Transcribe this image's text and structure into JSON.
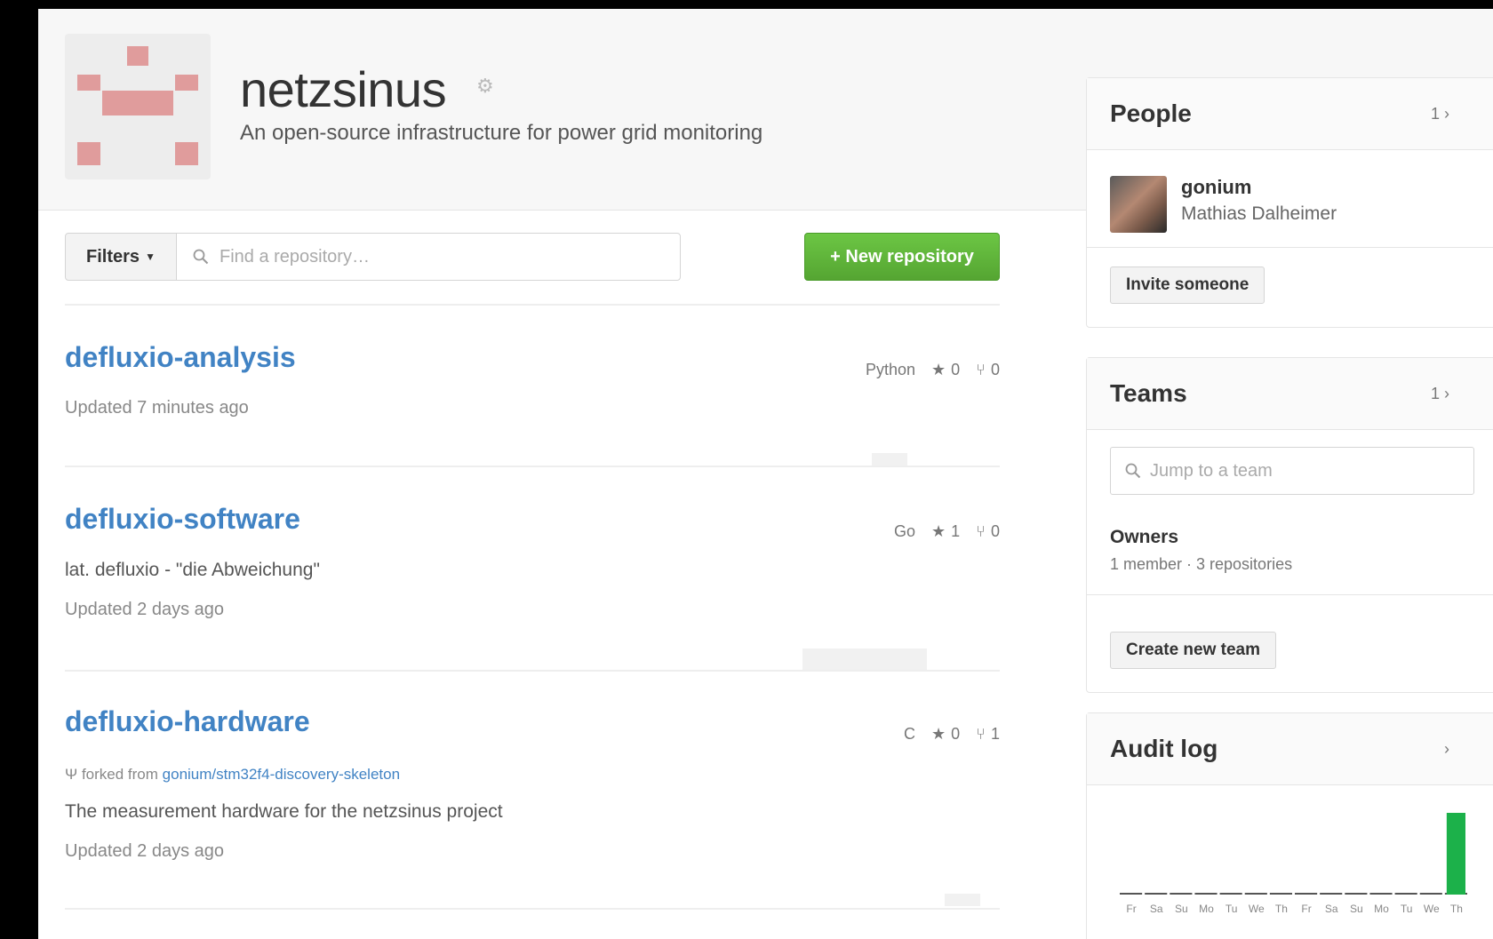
{
  "org": {
    "name": "netzsinus",
    "description": "An open-source infrastructure for power grid monitoring"
  },
  "toolbar": {
    "filters_label": "Filters",
    "search_placeholder": "Find a repository…",
    "new_repo_label": "+ New repository"
  },
  "repos": [
    {
      "name": "defluxio-analysis",
      "language": "Python",
      "stars": "0",
      "forks": "0",
      "description": "",
      "updated": "Updated 7 minutes ago"
    },
    {
      "name": "defluxio-software",
      "language": "Go",
      "stars": "1",
      "forks": "0",
      "description": "lat. defluxio - \"die Abweichung\"",
      "updated": "Updated 2 days ago"
    },
    {
      "name": "defluxio-hardware",
      "language": "C",
      "stars": "0",
      "forks": "1",
      "forked_prefix": "forked from",
      "forked_from": "gonium/stm32f4-discovery-skeleton",
      "description": "The measurement hardware for the netzsinus project",
      "updated": "Updated 2 days ago"
    }
  ],
  "people": {
    "title": "People",
    "count": "1",
    "member": {
      "login": "gonium",
      "name": "Mathias Dalheimer"
    },
    "invite_label": "Invite someone"
  },
  "teams": {
    "title": "Teams",
    "count": "1",
    "search_placeholder": "Jump to a team",
    "team_name": "Owners",
    "team_meta": "1 member · 3 repositories",
    "create_label": "Create new team"
  },
  "audit": {
    "title": "Audit log"
  },
  "chart_data": {
    "type": "bar",
    "categories": [
      "Fr",
      "Sa",
      "Su",
      "Mo",
      "Tu",
      "We",
      "Th",
      "Fr",
      "Sa",
      "Su",
      "Mo",
      "Tu",
      "We",
      "Th"
    ],
    "values": [
      0,
      0,
      0,
      0,
      0,
      0,
      0,
      0,
      0,
      0,
      0,
      0,
      0,
      1
    ],
    "title": "",
    "xlabel": "",
    "ylabel": "",
    "ylim": [
      0,
      1
    ],
    "bar_color": "#1cb14a",
    "baseline_color": "#555555"
  },
  "colors": {
    "link": "#4183c4",
    "green_button": "#55a532",
    "avatar_pixel": "#e09c9c"
  }
}
